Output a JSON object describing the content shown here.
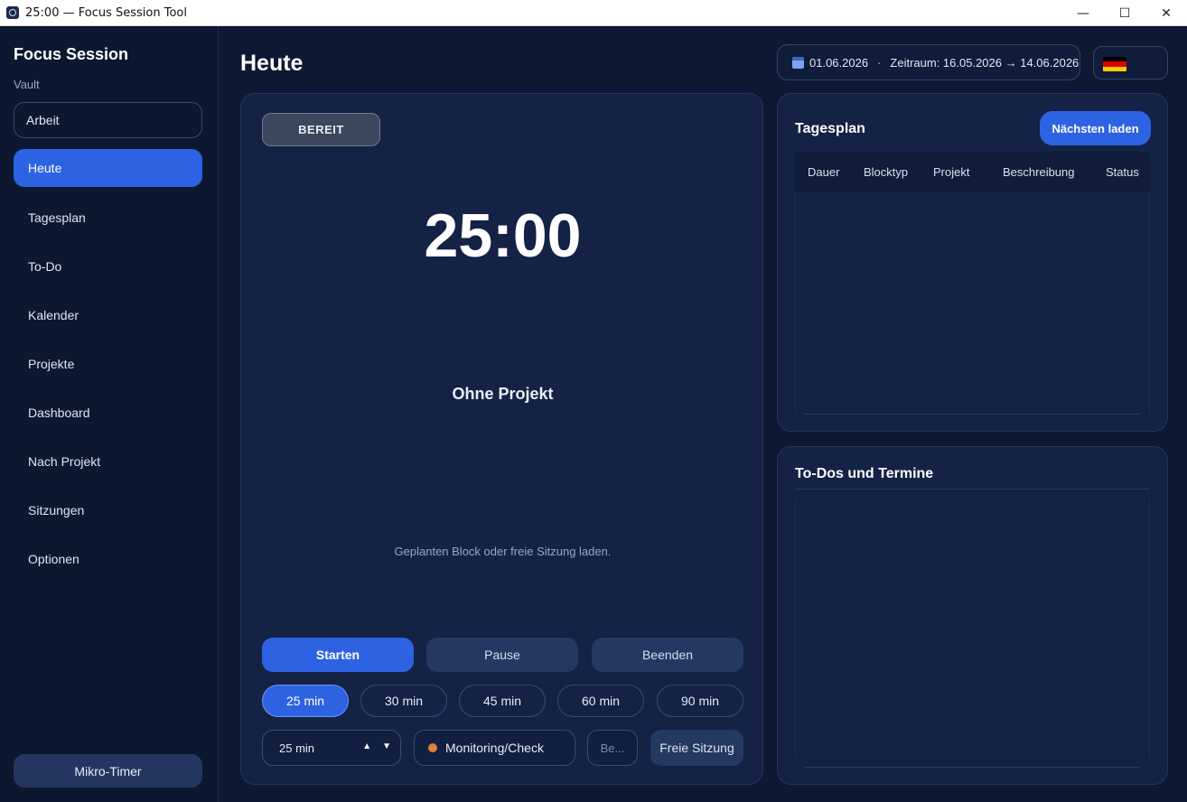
{
  "window": {
    "title": "25:00 — Focus Session Tool",
    "minimize": "—",
    "maximize": "☐",
    "close": "✕"
  },
  "sidebar": {
    "brand": "Focus Session",
    "vault_label": "Vault",
    "vault_value": "Arbeit",
    "items": [
      {
        "label": "Heute",
        "active": true
      },
      {
        "label": "Tagesplan"
      },
      {
        "label": "To-Do"
      },
      {
        "label": "Kalender"
      },
      {
        "label": "Projekte"
      },
      {
        "label": "Dashboard"
      },
      {
        "label": "Nach Projekt"
      },
      {
        "label": "Sitzungen"
      },
      {
        "label": "Optionen"
      }
    ],
    "micro_timer": "Mikro-Timer"
  },
  "header": {
    "title": "Heute",
    "date": "01.06.2026",
    "separator": "·",
    "range": "Zeitraum: 16.05.2026 → 14.06.2026",
    "language_flag": "de-flag-icon"
  },
  "timer": {
    "status": "BEREIT",
    "time": "25:00",
    "project": "Ohne Projekt",
    "hint": "Geplanten Block oder freie Sitzung laden.",
    "start": "Starten",
    "pause": "Pause",
    "stop": "Beenden",
    "presets": [
      "25 min",
      "30 min",
      "45 min",
      "60 min",
      "90 min"
    ],
    "active_preset": "25 min",
    "duration_value": "25 min",
    "block_type": "Monitoring/Check",
    "block_type_color": "#e08236",
    "description_placeholder": "Be...",
    "free_session": "Freie Sitzung"
  },
  "plan": {
    "title": "Tagesplan",
    "load_next": "Nächsten laden",
    "columns": [
      "Dauer",
      "Blocktyp",
      "Projekt",
      "Beschreibung",
      "Status"
    ],
    "rows": []
  },
  "todos": {
    "title": "To-Dos und Termine",
    "items": []
  },
  "colors": {
    "accent": "#2d63e2",
    "background": "#0d1833",
    "panel": "#132245"
  }
}
